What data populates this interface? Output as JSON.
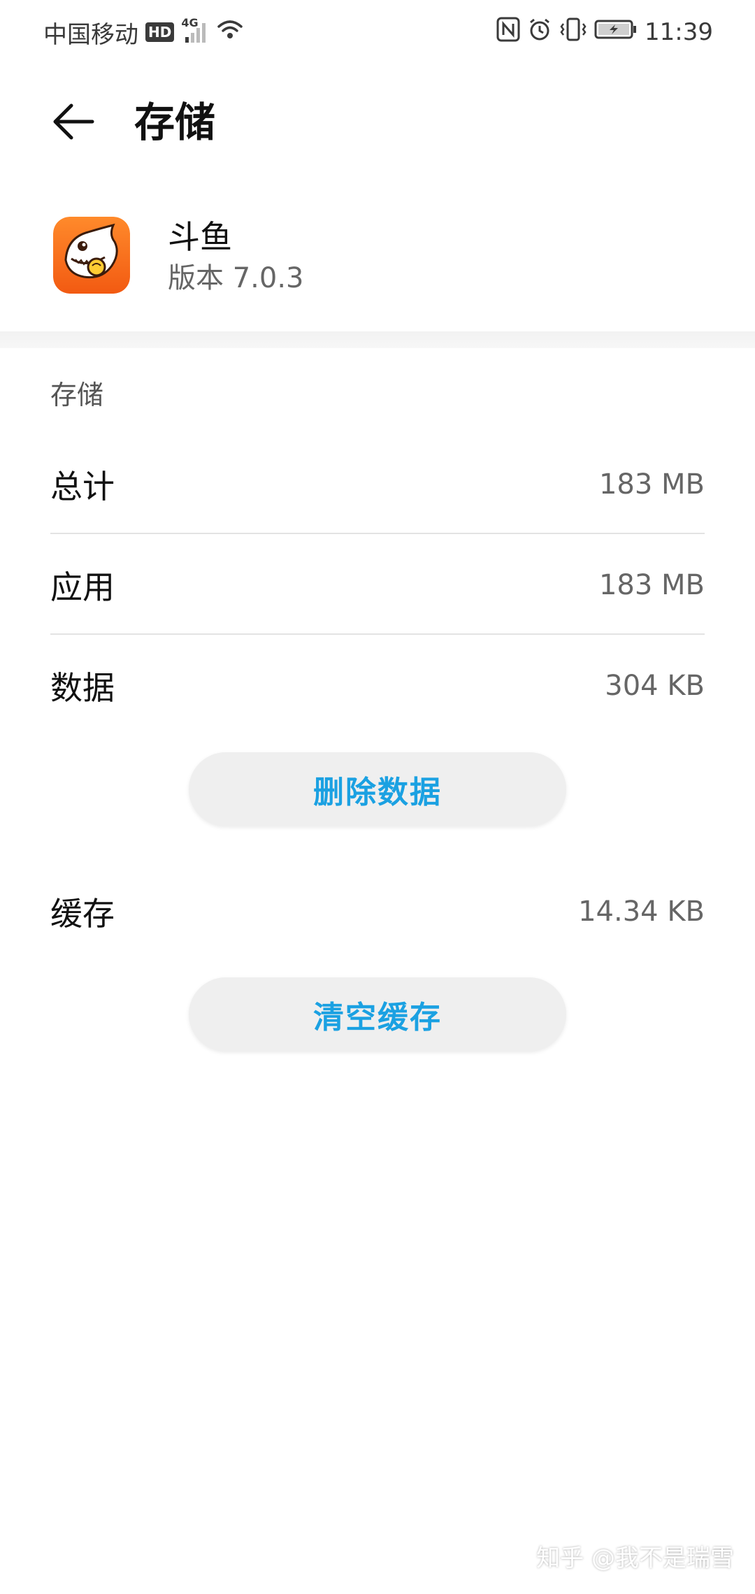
{
  "status_bar": {
    "carrier": "中国移动",
    "hd": "HD",
    "network": "4G",
    "time": "11:39"
  },
  "header": {
    "title": "存储"
  },
  "app": {
    "name": "斗鱼",
    "version": "版本 7.0.3",
    "icon": "douyu-shark-icon",
    "icon_color": "#f26b1d"
  },
  "storage": {
    "section_label": "存储",
    "rows": [
      {
        "label": "总计",
        "value": "183 MB"
      },
      {
        "label": "应用",
        "value": "183 MB"
      },
      {
        "label": "数据",
        "value": "304 KB"
      }
    ],
    "delete_data_label": "删除数据",
    "cache": {
      "label": "缓存",
      "value": "14.34 KB"
    },
    "clear_cache_label": "清空缓存"
  },
  "watermark": "知乎 @我不是瑞雪",
  "colors": {
    "accent": "#1ba1e2"
  }
}
